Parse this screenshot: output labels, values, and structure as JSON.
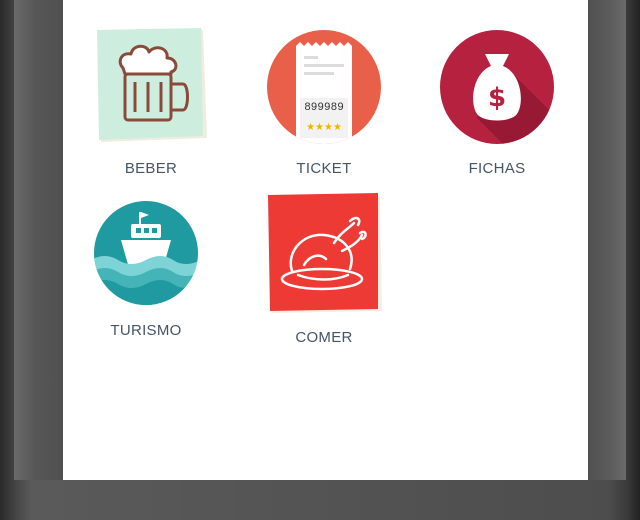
{
  "apps": [
    {
      "label": "BEBER",
      "icon": "beer-mug-icon",
      "color": "#c9eedd"
    },
    {
      "label": "TICKET",
      "icon": "ticket-icon",
      "color": "#e9604a",
      "ticket_number": "899989",
      "ticket_stars": "★★★★"
    },
    {
      "label": "FICHAS",
      "icon": "money-bag-icon",
      "color": "#b5213e"
    },
    {
      "label": "TURISMO",
      "icon": "ship-icon",
      "color": "#1f9aa0"
    },
    {
      "label": "COMER",
      "icon": "roast-chicken-icon",
      "color": "#ee3a35"
    }
  ]
}
